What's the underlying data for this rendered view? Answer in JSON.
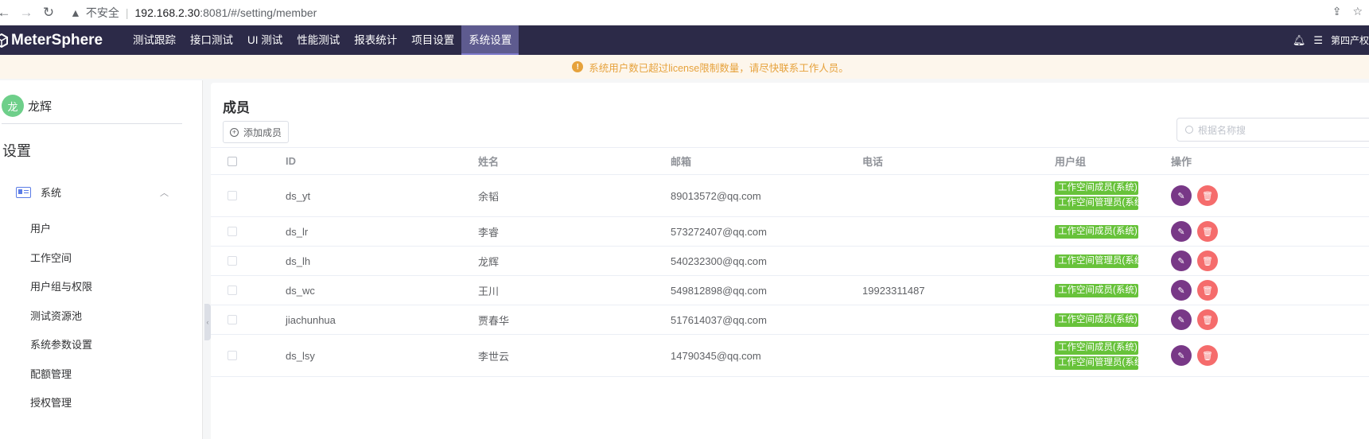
{
  "browser": {
    "insecure_label": "不安全",
    "url_host": "192.168.2.30",
    "url_path": ":8081/#/setting/member"
  },
  "header": {
    "logo": "MeterSphere",
    "menu": [
      {
        "label": "测试跟踪",
        "active": false
      },
      {
        "label": "接口测试",
        "active": false
      },
      {
        "label": "UI 测试",
        "active": false
      },
      {
        "label": "性能测试",
        "active": false
      },
      {
        "label": "报表统计",
        "active": false
      },
      {
        "label": "项目设置",
        "active": false
      },
      {
        "label": "系统设置",
        "active": true
      }
    ],
    "workspace": "第四产权"
  },
  "notice": {
    "text": "系统用户数已超过license限制数量，请尽快联系工作人员。"
  },
  "sidebar": {
    "avatar_char": "龙",
    "user_name": "龙辉",
    "title": "设置",
    "group_label": "系统",
    "items": [
      "用户",
      "工作空间",
      "用户组与权限",
      "测试资源池",
      "系统参数设置",
      "配额管理",
      "授权管理"
    ]
  },
  "main": {
    "title": "成员",
    "add_button": "添加成员",
    "search_placeholder": "根据名称搜",
    "columns": [
      "ID",
      "姓名",
      "邮箱",
      "电话",
      "用户组",
      "操作"
    ],
    "rows": [
      {
        "id": "ds_yt",
        "name": "余韬",
        "email": "89013572@qq.com",
        "phone": "",
        "groups": [
          "工作空间成员(系统)",
          "工作空间管理员(系统)"
        ]
      },
      {
        "id": "ds_lr",
        "name": "李睿",
        "email": "573272407@qq.com",
        "phone": "",
        "groups": [
          "工作空间成员(系统)"
        ]
      },
      {
        "id": "ds_lh",
        "name": "龙辉",
        "email": "540232300@qq.com",
        "phone": "",
        "groups": [
          "工作空间管理员(系统)"
        ]
      },
      {
        "id": "ds_wc",
        "name": "王川",
        "email": "549812898@qq.com",
        "phone": "19923311487",
        "groups": [
          "工作空间成员(系统)"
        ]
      },
      {
        "id": "jiachunhua",
        "name": "贾春华",
        "email": "517614037@qq.com",
        "phone": "",
        "groups": [
          "工作空间成员(系统)"
        ]
      },
      {
        "id": "ds_lsy",
        "name": "李世云",
        "email": "14790345@qq.com",
        "phone": "",
        "groups": [
          "工作空间成员(系统)",
          "工作空间管理员(系统)"
        ]
      }
    ]
  },
  "colors": {
    "header_bg": "#2c2a48",
    "active_menu": "#5e5b8f",
    "tag_green": "#67c23a",
    "edit_purple": "#783887",
    "delete_red": "#f56c6c",
    "warning": "#e6a23c"
  },
  "icons": {
    "edit": "edit-icon",
    "delete": "delete-icon",
    "bell": "bell-icon",
    "task": "task-list-icon"
  }
}
